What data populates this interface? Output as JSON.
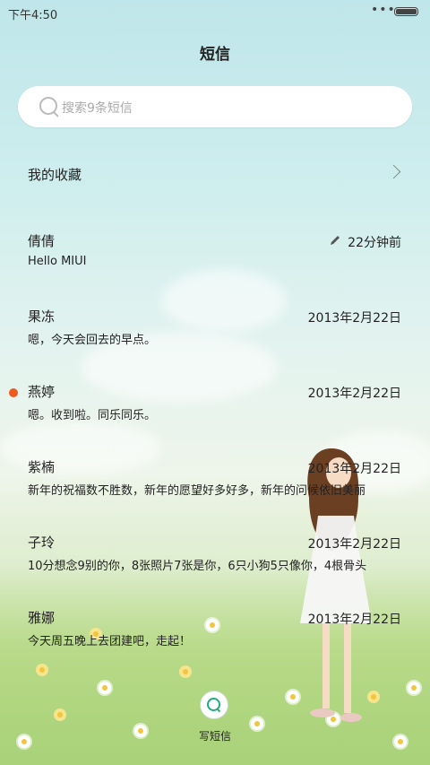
{
  "status_bar": {
    "time": "下午4:50",
    "more_glyph": "•••"
  },
  "title": "短信",
  "search": {
    "placeholder": "搜索9条短信"
  },
  "favorites": {
    "label": "我的收藏"
  },
  "messages": [
    {
      "name": "倩倩",
      "date": "22分钟前",
      "preview": "Hello MIUI",
      "unread": false,
      "draft_icon": "pencil-icon"
    },
    {
      "name": "果冻",
      "date": "2013年2月22日",
      "preview": "嗯，今天会回去的早点。",
      "unread": false
    },
    {
      "name": "燕婷",
      "date": "2013年2月22日",
      "preview": "嗯。收到啦。同乐同乐。",
      "unread": true
    },
    {
      "name": "紫楠",
      "date": "2013年2月22日",
      "preview": "新年的祝福数不胜数，新年的愿望好多好多，新年的问候依旧美丽",
      "unread": false
    },
    {
      "name": "子玲",
      "date": "2013年2月22日",
      "preview": "10分想念9别的你，8张照片7张是你，6只小狗5只像你，4根骨头",
      "unread": false
    },
    {
      "name": "雅娜",
      "date": "2013年2月22日",
      "preview": "今天周五晚上去团建吧，走起！",
      "unread": false
    }
  ],
  "compose": {
    "label": "写短信"
  },
  "colors": {
    "unread_dot": "#f0591e",
    "compose_accent": "#18b07c"
  }
}
